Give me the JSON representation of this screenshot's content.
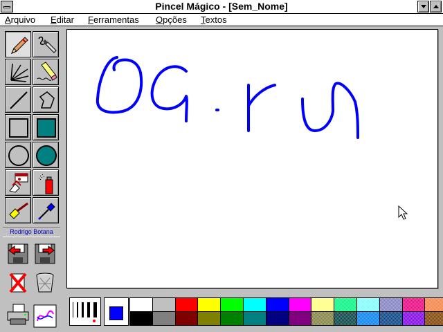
{
  "window": {
    "title": "Pincel Mágico - [Sem_Nome]"
  },
  "menu": [
    {
      "pre": "",
      "ul": "A",
      "post": "rquivo"
    },
    {
      "pre": "",
      "ul": "E",
      "post": "ditar"
    },
    {
      "pre": "",
      "ul": "F",
      "post": "erramentas"
    },
    {
      "pre": "",
      "ul": "O",
      "post": "pções"
    },
    {
      "pre": "",
      "ul": "T",
      "post": "extos"
    }
  ],
  "tools": [
    {
      "name": "pencil-tool",
      "icon": "pencil-icon",
      "pressed": true
    },
    {
      "name": "brush-tool",
      "icon": "brush-icon",
      "pressed": false
    },
    {
      "name": "rays-tool",
      "icon": "rays-icon",
      "pressed": false
    },
    {
      "name": "eraser-tool",
      "icon": "eraser-icon",
      "pressed": false
    },
    {
      "name": "line-tool",
      "icon": "line-icon",
      "pressed": false
    },
    {
      "name": "polygon-tool",
      "icon": "polygon-icon",
      "pressed": false
    },
    {
      "name": "rectangle-tool",
      "icon": "rectangle-icon",
      "pressed": false
    },
    {
      "name": "filled-rectangle-tool",
      "icon": "filled-rectangle-icon",
      "pressed": false
    },
    {
      "name": "ellipse-tool",
      "icon": "ellipse-icon",
      "pressed": false
    },
    {
      "name": "filled-ellipse-tool",
      "icon": "filled-ellipse-icon",
      "pressed": false
    },
    {
      "name": "stamp-tool",
      "icon": "stamp-icon",
      "pressed": false
    },
    {
      "name": "spray-tool",
      "icon": "spray-can-icon",
      "pressed": false
    },
    {
      "name": "fill-tool",
      "icon": "paint-brush-icon",
      "pressed": false
    },
    {
      "name": "eyedropper-tool",
      "icon": "eyedropper-icon",
      "pressed": false
    }
  ],
  "credit": "Rodrigo Botana",
  "file_buttons": [
    {
      "name": "open-file-button",
      "icon": "floppy-open-icon"
    },
    {
      "name": "save-file-button",
      "icon": "floppy-save-icon"
    },
    {
      "name": "clear-button",
      "icon": "red-x-icon"
    },
    {
      "name": "trash-button",
      "icon": "trash-can-icon"
    },
    {
      "name": "print-button",
      "icon": "printer-icon"
    },
    {
      "name": "preview-button",
      "icon": "preview-icon"
    }
  ],
  "current_color": "#0000ff",
  "palette_top": [
    "#ffffff",
    "#c0c0c0",
    "#ff0000",
    "#ffff00",
    "#00ff00",
    "#00ffff",
    "#0000ff",
    "#ff00ff",
    "#ffff80",
    "#00ff80",
    "#80ffff",
    "#8080c0",
    "#ff0080",
    "#ff8040"
  ],
  "palette_bottom": [
    "#000000",
    "#808080",
    "#800000",
    "#808000",
    "#008000",
    "#008080",
    "#000080",
    "#800080",
    "#808040",
    "#004040",
    "#0080ff",
    "#004080",
    "#8000ff",
    "#804000"
  ],
  "palette_patterned": [
    false,
    false,
    false,
    false,
    false,
    false,
    false,
    false,
    true,
    true,
    true,
    true,
    true,
    true
  ]
}
